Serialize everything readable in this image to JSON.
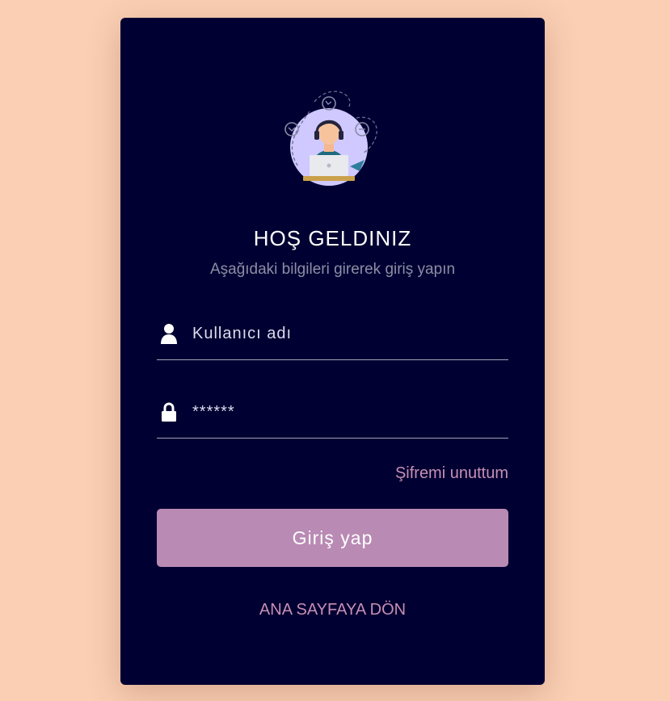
{
  "login": {
    "title": "HOŞ GELDINIZ",
    "subtitle": "Aşağıdaki bilgileri girerek giriş yapın",
    "username_placeholder": "Kullanıcı adı",
    "password_placeholder": "******",
    "forgot_label": "Şifremi unuttum",
    "submit_label": "Giriş yap",
    "home_label": "ANA SAYFAYA DÖN"
  },
  "icons": {
    "illustration": "support-agent-illustration",
    "username": "user-icon",
    "password": "lock-icon"
  },
  "colors": {
    "page_background": "#facfb4",
    "card_background": "#000032",
    "accent": "#b98ab4",
    "link": "#c78fb3",
    "subtitle": "#8d8da6"
  }
}
